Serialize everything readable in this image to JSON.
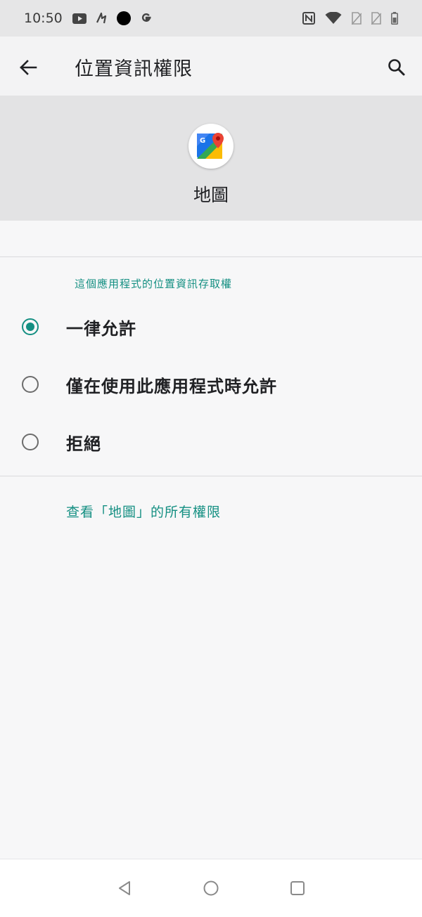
{
  "status_bar": {
    "time": "10:50",
    "left_icons": [
      "youtube-icon",
      "gesture-app-icon",
      "dot-icon",
      "google-icon"
    ],
    "right_icons": [
      "nfc-icon",
      "wifi-icon",
      "no-sim-icon",
      "no-sim-icon",
      "battery-icon"
    ]
  },
  "app_bar": {
    "title": "位置資訊權限",
    "back_icon": "back-arrow-icon",
    "search_icon": "search-icon"
  },
  "app_header": {
    "app_name": "地圖",
    "app_icon": "google-maps-icon"
  },
  "permission": {
    "section_header": "這個應用程式的位置資訊存取權",
    "options": [
      {
        "label": "一律允許",
        "selected": true
      },
      {
        "label": "僅在使用此應用程式時允許",
        "selected": false
      },
      {
        "label": "拒絕",
        "selected": false
      }
    ],
    "see_all_link": "查看「地圖」的所有權限"
  },
  "nav_bar": {
    "icons": [
      "nav-back-icon",
      "nav-home-icon",
      "nav-recents-icon"
    ]
  },
  "colors": {
    "accent": "#148f82",
    "header_bg": "#e3e3e4",
    "status_bar_bg": "#e6e6e7"
  }
}
